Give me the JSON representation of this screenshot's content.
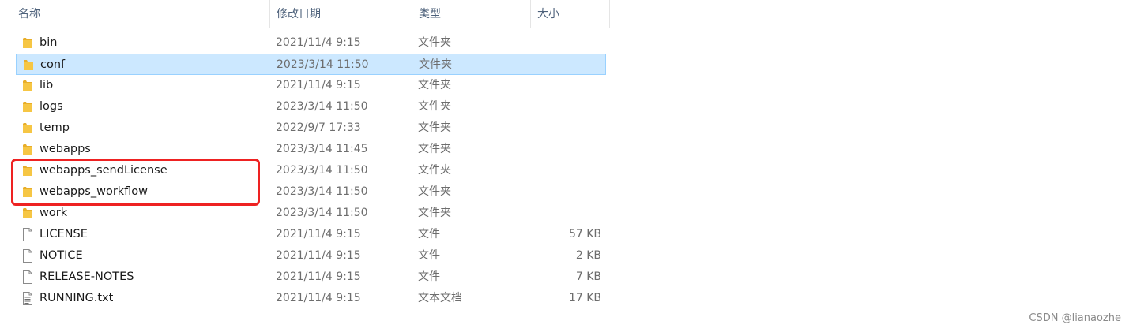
{
  "columns": {
    "name": "名称",
    "date_modified": "修改日期",
    "type": "类型",
    "size": "大小"
  },
  "sort": {
    "column": "name",
    "icon": "chevron-up-icon"
  },
  "files": [
    {
      "name": "bin",
      "date": "2021/11/4 9:15",
      "type": "文件夹",
      "size": "",
      "icon": "folder-icon",
      "selected": false
    },
    {
      "name": "conf",
      "date": "2023/3/14 11:50",
      "type": "文件夹",
      "size": "",
      "icon": "folder-icon",
      "selected": true
    },
    {
      "name": "lib",
      "date": "2021/11/4 9:15",
      "type": "文件夹",
      "size": "",
      "icon": "folder-icon",
      "selected": false
    },
    {
      "name": "logs",
      "date": "2023/3/14 11:50",
      "type": "文件夹",
      "size": "",
      "icon": "folder-icon",
      "selected": false
    },
    {
      "name": "temp",
      "date": "2022/9/7 17:33",
      "type": "文件夹",
      "size": "",
      "icon": "folder-icon",
      "selected": false
    },
    {
      "name": "webapps",
      "date": "2023/3/14 11:45",
      "type": "文件夹",
      "size": "",
      "icon": "folder-icon",
      "selected": false
    },
    {
      "name": "webapps_sendLicense",
      "date": "2023/3/14 11:50",
      "type": "文件夹",
      "size": "",
      "icon": "folder-icon",
      "selected": false
    },
    {
      "name": "webapps_workflow",
      "date": "2023/3/14 11:50",
      "type": "文件夹",
      "size": "",
      "icon": "folder-icon",
      "selected": false
    },
    {
      "name": "work",
      "date": "2023/3/14 11:50",
      "type": "文件夹",
      "size": "",
      "icon": "folder-icon",
      "selected": false
    },
    {
      "name": "LICENSE",
      "date": "2021/11/4 9:15",
      "type": "文件",
      "size": "57 KB",
      "icon": "file-icon",
      "selected": false
    },
    {
      "name": "NOTICE",
      "date": "2021/11/4 9:15",
      "type": "文件",
      "size": "2 KB",
      "icon": "file-icon",
      "selected": false
    },
    {
      "name": "RELEASE-NOTES",
      "date": "2021/11/4 9:15",
      "type": "文件",
      "size": "7 KB",
      "icon": "file-icon",
      "selected": false
    },
    {
      "name": "RUNNING.txt",
      "date": "2021/11/4 9:15",
      "type": "文本文档",
      "size": "17 KB",
      "icon": "text-file-icon",
      "selected": false
    }
  ],
  "annotation": {
    "highlighted_items": [
      "webapps_sendLicense",
      "webapps_workflow"
    ],
    "color": "#ee2222"
  },
  "colors": {
    "selection_bg": "#cce8ff",
    "selection_border": "#99d1ff",
    "folder": "#f6c644"
  },
  "watermark": "CSDN @lianaozhe"
}
